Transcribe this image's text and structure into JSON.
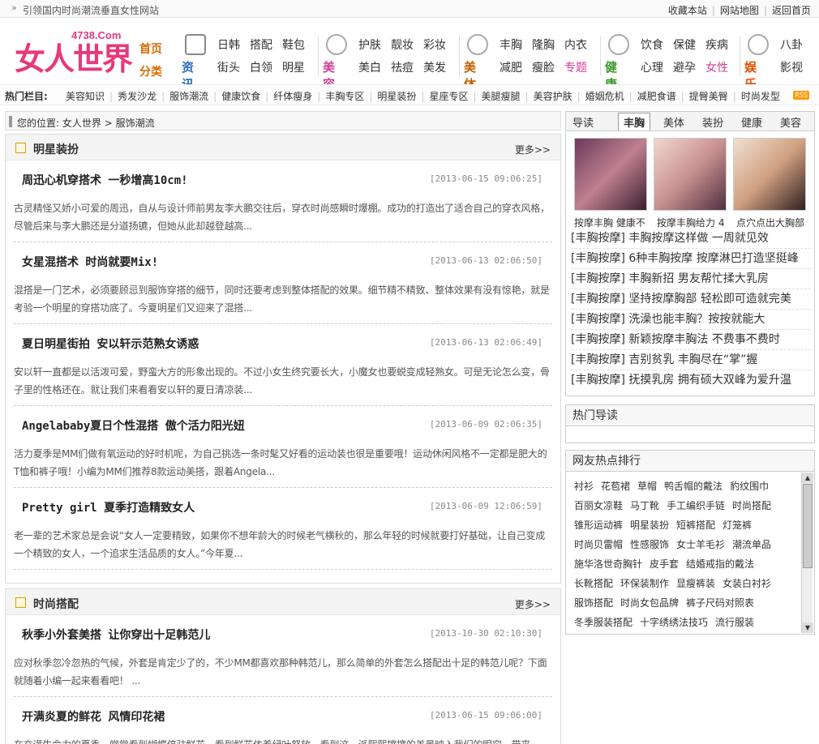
{
  "topbar": {
    "slogan": "引领国内时尚潮流垂直女性网站",
    "links": [
      "收藏本站",
      "网站地图",
      "返回首页"
    ]
  },
  "logo": {
    "main": "女人世界",
    "domain": "4738.Com"
  },
  "nav": {
    "home": [
      "首页",
      "分类"
    ],
    "groups": [
      {
        "label": "资讯",
        "color": "#2a6ebb",
        "items": [
          "日韩",
          "搭配",
          "鞋包",
          "街头",
          "白领",
          "明星"
        ]
      },
      {
        "label": "美容",
        "color": "#d23c96",
        "items": [
          "护肤",
          "靓妆",
          "彩妆",
          "美白",
          "祛痘",
          "美发"
        ]
      },
      {
        "label": "美体",
        "color": "#c06000",
        "items": [
          "丰胸",
          "隆胸",
          "内衣",
          "减肥",
          "瘦脸",
          "专题"
        ]
      },
      {
        "label": "健康",
        "color": "#3a9a2a",
        "items": [
          "饮食",
          "保健",
          "疾病",
          "心理",
          "避孕",
          "女性"
        ]
      },
      {
        "label": "娱乐",
        "color": "#e05000",
        "items": [
          "八卦",
          "影视"
        ]
      }
    ]
  },
  "hot": {
    "label": "热门栏目:",
    "items": [
      "美容知识",
      "秀发沙龙",
      "服饰潮流",
      "健康饮食",
      "纤体瘦身",
      "丰胸专区",
      "明星装扮",
      "星座专区",
      "美腿瘦腿",
      "美容护肤",
      "婚姻危机",
      "减肥食谱",
      "提臀美臀",
      "时尚发型"
    ],
    "rss": "RSS"
  },
  "crumb": {
    "label": "您的位置:",
    "path": [
      "女人世界",
      "服饰潮流"
    ]
  },
  "sections": [
    {
      "title": "明星装扮",
      "more": "更多>>",
      "articles": [
        {
          "title": "周迅心机穿搭术 一秒增高10cm!",
          "date": "[2013-06-15 09:06:25]",
          "desc": "古灵精怪又娇小可爱的周迅，自从与设计师前男友李大鹏交往后，穿衣时尚感瞬时爆棚。成功的打造出了适合自己的穿衣风格，尽管后来与李大鹏还是分道扬镳，但她从此却越登越高..."
        },
        {
          "title": "女星混搭术 时尚就要Mix!",
          "date": "[2013-06-13 02:06:50]",
          "desc": "混搭是一门艺术，必须要顾忌到服饰穿搭的细节，同时还要考虑到整体搭配的效果。细节精不精致、整体效果有没有惊艳，就是考验一个明星的穿搭功底了。今夏明星们又迎来了混搭..."
        },
        {
          "title": "夏日明星街拍 安以轩示范熟女诱惑",
          "date": "[2013-06-13 02:06:49]",
          "desc": "安以轩一直都是以活泼可爱，野蛮大方的形象出现的。不过小女生终究要长大，小魔女也要蜕变成轻熟女。可是无论怎么变，骨子里的性格还在。就让我们来看看安以轩的夏日清凉装..."
        },
        {
          "title": "Angelababy夏日个性混搭 傲个活力阳光妞",
          "date": "[2013-06-09 02:06:35]",
          "desc": "活力夏季是MM们做有氧运动的好时机呢，为自己挑选一条时髦又好看的运动装也很是重要哦！运动休闲风格不一定都是肥大的T恤和裤子哦！小编为MM们推荐8款运动美搭，跟着Angela..."
        },
        {
          "title": "Pretty girl 夏季打造精致女人",
          "date": "[2013-06-09 12:06:59]",
          "desc": "老一辈的艺术家总是会说“女人一定要精致，如果你不想年龄大的时候老气横秋的，那么年轻的时候就要打好基础，让自己变成一个精致的女人，一个追求生活品质的女人。”今年夏..."
        }
      ]
    },
    {
      "title": "时尚搭配",
      "more": "更多>>",
      "articles": [
        {
          "title": "秋季小外套美搭 让你穿出十足韩范儿",
          "date": "[2013-10-30 02:10:30]",
          "desc": "应对秋季忽冷忽热的气候，外套是肯定少了的，不少MM都喜欢那种韩范儿，那么简单的外套怎么搭配出十足的韩范儿呢？下面就随着小编一起来看看吧！ ..."
        },
        {
          "title": "开满炎夏的鲜花 风情印花裙",
          "date": "[2013-06-15 09:06:00]",
          "desc": "在充满生命力的夏季，常常看到蝴蝶停驻鲜花、看到鲜花依着绿叶怒放、看到这一派熙熙攘攘的美景映入我们的眼帘，带来..."
        }
      ]
    }
  ],
  "right": {
    "tabs": [
      "导读",
      "丰胸",
      "美体",
      "装扮",
      "健康",
      "美容"
    ],
    "thumbs": [
      "按摩丰胸 健康不",
      "按摩丰胸给力 4",
      "点穴点出大胸部"
    ],
    "list": [
      "[丰胸按摩] 丰胸按摩这样做 一周就见效",
      "[丰胸按摩] 6种丰胸按摩 按摩淋巴打造坚挺峰",
      "[丰胸按摩] 丰胸新招 男友帮忙揉大乳房",
      "[丰胸按摩] 坚持按摩胸部 轻松即可造就完美",
      "[丰胸按摩] 洗澡也能丰胸？按按就能大",
      "[丰胸按摩] 新颖按摩丰胸法 不费事不费时",
      "[丰胸按摩] 吉别贫乳 丰胸尽在“掌”握",
      "[丰胸按摩] 抚摸乳房 拥有硕大双峰为爱升温"
    ],
    "hot_title": "热门导读",
    "rank_title": "网友热点排行",
    "tags": [
      "衬衫",
      "花苞裙",
      "草帽",
      "鸭舌帽的戴法",
      "豹纹围巾",
      "百丽女凉鞋",
      "马丁靴",
      "手工编织手链",
      "时尚搭配",
      "锥形运动裤",
      "明星装扮",
      "短裤搭配",
      "灯笼裤",
      "时尚贝雷帽",
      "性感服饰",
      "女士羊毛衫",
      "潮流单品",
      "施华洛世奇胸针",
      "皮手套",
      "结婚戒指的戴法",
      "长靴搭配",
      "环保装制作",
      "显瘦裤装",
      "女装白衬衫",
      "服饰搭配",
      "时尚女包品牌",
      "裤子尺码对照表",
      "冬季服装搭配",
      "十字绣绣法技巧",
      "流行服装"
    ]
  }
}
